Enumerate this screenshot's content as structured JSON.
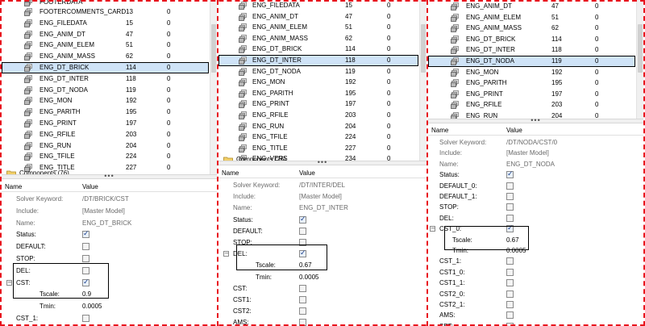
{
  "panels": [
    {
      "tree_partial_top": "FOOTERDATA",
      "tree": [
        {
          "name": "FOOTERCOMMENTS_CARD",
          "id": "13",
          "count": "0"
        },
        {
          "name": "ENG_FILEDATA",
          "id": "15",
          "count": "0"
        },
        {
          "name": "ENG_ANIM_DT",
          "id": "47",
          "count": "0"
        },
        {
          "name": "ENG_ANIM_ELEM",
          "id": "51",
          "count": "0"
        },
        {
          "name": "ENG_ANIM_MASS",
          "id": "62",
          "count": "0"
        },
        {
          "name": "ENG_DT_BRICK",
          "id": "114",
          "count": "0",
          "selected": true
        },
        {
          "name": "ENG_DT_INTER",
          "id": "118",
          "count": "0"
        },
        {
          "name": "ENG_DT_NODA",
          "id": "119",
          "count": "0"
        },
        {
          "name": "ENG_MON",
          "id": "192",
          "count": "0"
        },
        {
          "name": "ENG_PARITH",
          "id": "195",
          "count": "0"
        },
        {
          "name": "ENG_PRINT",
          "id": "197",
          "count": "0"
        },
        {
          "name": "ENG_RFILE",
          "id": "203",
          "count": "0"
        },
        {
          "name": "ENG_RUN",
          "id": "204",
          "count": "0"
        },
        {
          "name": "ENG_TFILE",
          "id": "224",
          "count": "0"
        },
        {
          "name": "ENG_TITLE",
          "id": "227",
          "count": "0"
        },
        {
          "name": "ENG_VERS",
          "id": "234",
          "count": "0"
        }
      ],
      "tree_partial_bottom": "Components (76)",
      "header": {
        "name": "Name",
        "value": "Value"
      },
      "props": [
        {
          "key": "Solver Keyword:",
          "value": "/DT/BRICK/CST",
          "grey": true
        },
        {
          "key": "Include:",
          "value": "[Master Model]",
          "grey": true
        },
        {
          "key": "Name:",
          "value": "ENG_DT_BRICK",
          "grey": true
        },
        {
          "key": "Status:",
          "check": true
        },
        {
          "key": "DEFAULT:",
          "check": false
        },
        {
          "key": "STOP:",
          "check": false
        },
        {
          "key": "DEL:",
          "check": false
        },
        {
          "key": "CST:",
          "check": true,
          "group": true
        },
        {
          "key": "Tscale:",
          "value": "0.9",
          "sub": true
        },
        {
          "key": "Tmin:",
          "value": "0.0005",
          "sub": true
        },
        {
          "key": "CST_1:",
          "check": false
        }
      ]
    },
    {
      "tree": [
        {
          "name": "ENG_FILEDATA",
          "id": "15",
          "count": "0"
        },
        {
          "name": "ENG_ANIM_DT",
          "id": "47",
          "count": "0"
        },
        {
          "name": "ENG_ANIM_ELEM",
          "id": "51",
          "count": "0"
        },
        {
          "name": "ENG_ANIM_MASS",
          "id": "62",
          "count": "0"
        },
        {
          "name": "ENG_DT_BRICK",
          "id": "114",
          "count": "0"
        },
        {
          "name": "ENG_DT_INTER",
          "id": "118",
          "count": "0",
          "selected": true
        },
        {
          "name": "ENG_DT_NODA",
          "id": "119",
          "count": "0"
        },
        {
          "name": "ENG_MON",
          "id": "192",
          "count": "0"
        },
        {
          "name": "ENG_PARITH",
          "id": "195",
          "count": "0"
        },
        {
          "name": "ENG_PRINT",
          "id": "197",
          "count": "0"
        },
        {
          "name": "ENG_RFILE",
          "id": "203",
          "count": "0"
        },
        {
          "name": "ENG_RUN",
          "id": "204",
          "count": "0"
        },
        {
          "name": "ENG_TFILE",
          "id": "224",
          "count": "0"
        },
        {
          "name": "ENG_TITLE",
          "id": "227",
          "count": "0"
        },
        {
          "name": "ENG_VERS",
          "id": "234",
          "count": "0"
        }
      ],
      "tree_partial_bottom": "Components (76)",
      "header": {
        "name": "Name",
        "value": "Value"
      },
      "props": [
        {
          "key": "Solver Keyword:",
          "value": "/DT/INTER/DEL",
          "grey": true
        },
        {
          "key": "Include:",
          "value": "[Master Model]",
          "grey": true
        },
        {
          "key": "Name:",
          "value": "ENG_DT_INTER",
          "grey": true
        },
        {
          "key": "Status:",
          "check": true
        },
        {
          "key": "DEFAULT:",
          "check": false
        },
        {
          "key": "STOP:",
          "check": false
        },
        {
          "key": "DEL:",
          "check": true,
          "group": true
        },
        {
          "key": "Tscale:",
          "value": "0.67",
          "sub": true
        },
        {
          "key": "Tmin:",
          "value": "0.0005",
          "sub": true
        },
        {
          "key": "CST:",
          "check": false
        },
        {
          "key": "CST1:",
          "check": false
        },
        {
          "key": "CST2:",
          "check": false
        },
        {
          "key": "AMS:",
          "check": false
        }
      ]
    },
    {
      "tree": [
        {
          "name": "ENG_ANIM_DT",
          "id": "47",
          "count": "0"
        },
        {
          "name": "ENG_ANIM_ELEM",
          "id": "51",
          "count": "0"
        },
        {
          "name": "ENG_ANIM_MASS",
          "id": "62",
          "count": "0"
        },
        {
          "name": "ENG_DT_BRICK",
          "id": "114",
          "count": "0"
        },
        {
          "name": "ENG_DT_INTER",
          "id": "118",
          "count": "0"
        },
        {
          "name": "ENG_DT_NODA",
          "id": "119",
          "count": "0",
          "selected": true
        },
        {
          "name": "ENG_MON",
          "id": "192",
          "count": "0"
        },
        {
          "name": "ENG_PARITH",
          "id": "195",
          "count": "0"
        },
        {
          "name": "ENG_PRINT",
          "id": "197",
          "count": "0"
        },
        {
          "name": "ENG_RFILE",
          "id": "203",
          "count": "0"
        },
        {
          "name": "ENG_RUN",
          "id": "204",
          "count": "0"
        }
      ],
      "header": {
        "name": "Name",
        "value": "Value"
      },
      "props": [
        {
          "key": "Solver Keyword:",
          "value": "/DT/NODA/CST/0",
          "grey": true
        },
        {
          "key": "Include:",
          "value": "[Master Model]",
          "grey": true
        },
        {
          "key": "Name:",
          "value": "ENG_DT_NODA",
          "grey": true
        },
        {
          "key": "Status:",
          "check": true
        },
        {
          "key": "DEFAULT_0:",
          "check": false
        },
        {
          "key": "DEFAULT_1:",
          "check": false
        },
        {
          "key": "STOP:",
          "check": false
        },
        {
          "key": "DEL:",
          "check": false
        },
        {
          "key": "CST_0:",
          "check": true,
          "group": true
        },
        {
          "key": "Tscale:",
          "value": "0.67",
          "sub": true
        },
        {
          "key": "Tmin:",
          "value": "0.0005",
          "sub": true
        },
        {
          "key": "CST_1:",
          "check": false
        },
        {
          "key": "CST1_0:",
          "check": false
        },
        {
          "key": "CST1_1:",
          "check": false
        },
        {
          "key": "CST2_0:",
          "check": false
        },
        {
          "key": "CST2_1:",
          "check": false
        },
        {
          "key": "AMS:",
          "check": false
        },
        {
          "key": "SET:",
          "check": false
        }
      ]
    }
  ]
}
